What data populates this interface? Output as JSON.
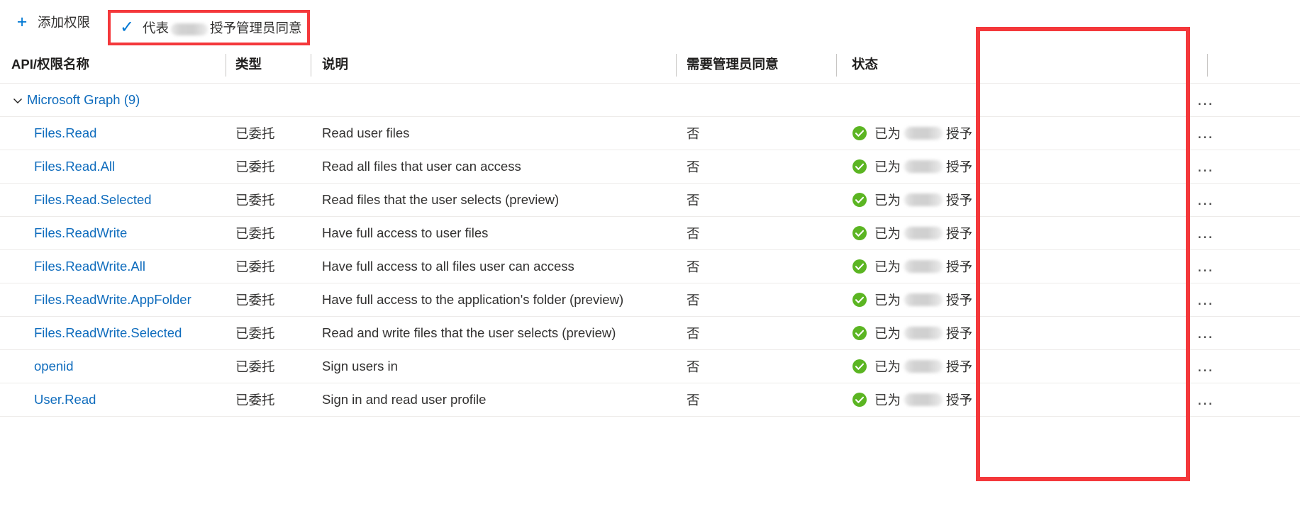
{
  "toolbar": {
    "add_permission": {
      "label": "添加权限",
      "icon": "plus-icon",
      "glyph": "+"
    },
    "grant_consent": {
      "label_before": "代表",
      "label_after": "授予管理员同意",
      "redacted": true,
      "icon": "checkmark-icon",
      "glyph": "✓"
    }
  },
  "table": {
    "headers": {
      "name": "API/权限名称",
      "type": "类型",
      "description": "说明",
      "admin_consent": "需要管理员同意",
      "status": "状态"
    },
    "group": {
      "label": "Microsoft Graph (9)",
      "expanded": true,
      "chevron": "chevron-down-icon"
    },
    "rows": [
      {
        "name": "Files.Read",
        "type": "已委托",
        "description": "Read user files",
        "admin_consent": "否",
        "status_prefix": "已为",
        "status_suffix": "授予",
        "status_icon": "success-check-icon"
      },
      {
        "name": "Files.Read.All",
        "type": "已委托",
        "description": "Read all files that user can access",
        "admin_consent": "否",
        "status_prefix": "已为",
        "status_suffix": "授予",
        "status_icon": "success-check-icon"
      },
      {
        "name": "Files.Read.Selected",
        "type": "已委托",
        "description": "Read files that the user selects (preview)",
        "admin_consent": "否",
        "status_prefix": "已为",
        "status_suffix": "授予",
        "status_icon": "success-check-icon"
      },
      {
        "name": "Files.ReadWrite",
        "type": "已委托",
        "description": "Have full access to user files",
        "admin_consent": "否",
        "status_prefix": "已为",
        "status_suffix": "授予",
        "status_icon": "success-check-icon"
      },
      {
        "name": "Files.ReadWrite.All",
        "type": "已委托",
        "description": "Have full access to all files user can access",
        "admin_consent": "否",
        "status_prefix": "已为",
        "status_suffix": "授予",
        "status_icon": "success-check-icon"
      },
      {
        "name": "Files.ReadWrite.AppFolder",
        "type": "已委托",
        "description": "Have full access to the application's folder (preview)",
        "admin_consent": "否",
        "status_prefix": "已为",
        "status_suffix": "授予",
        "status_icon": "success-check-icon"
      },
      {
        "name": "Files.ReadWrite.Selected",
        "type": "已委托",
        "description": "Read and write files that the user selects (preview)",
        "admin_consent": "否",
        "status_prefix": "已为",
        "status_suffix": "授予",
        "status_icon": "success-check-icon"
      },
      {
        "name": "openid",
        "type": "已委托",
        "description": "Sign users in",
        "admin_consent": "否",
        "status_prefix": "已为",
        "status_suffix": "授予",
        "status_icon": "success-check-icon"
      },
      {
        "name": "User.Read",
        "type": "已委托",
        "description": "Sign in and read user profile",
        "admin_consent": "否",
        "status_prefix": "已为",
        "status_suffix": "授予",
        "status_icon": "success-check-icon"
      }
    ],
    "row_menu": {
      "label": "…",
      "icon": "more-actions-icon"
    }
  },
  "colors": {
    "link": "#0f6cbd",
    "accent": "#0078d4",
    "success": "#5bb522",
    "highlight": "#f4383b",
    "text": "#323130",
    "divider": "#edebe9"
  }
}
